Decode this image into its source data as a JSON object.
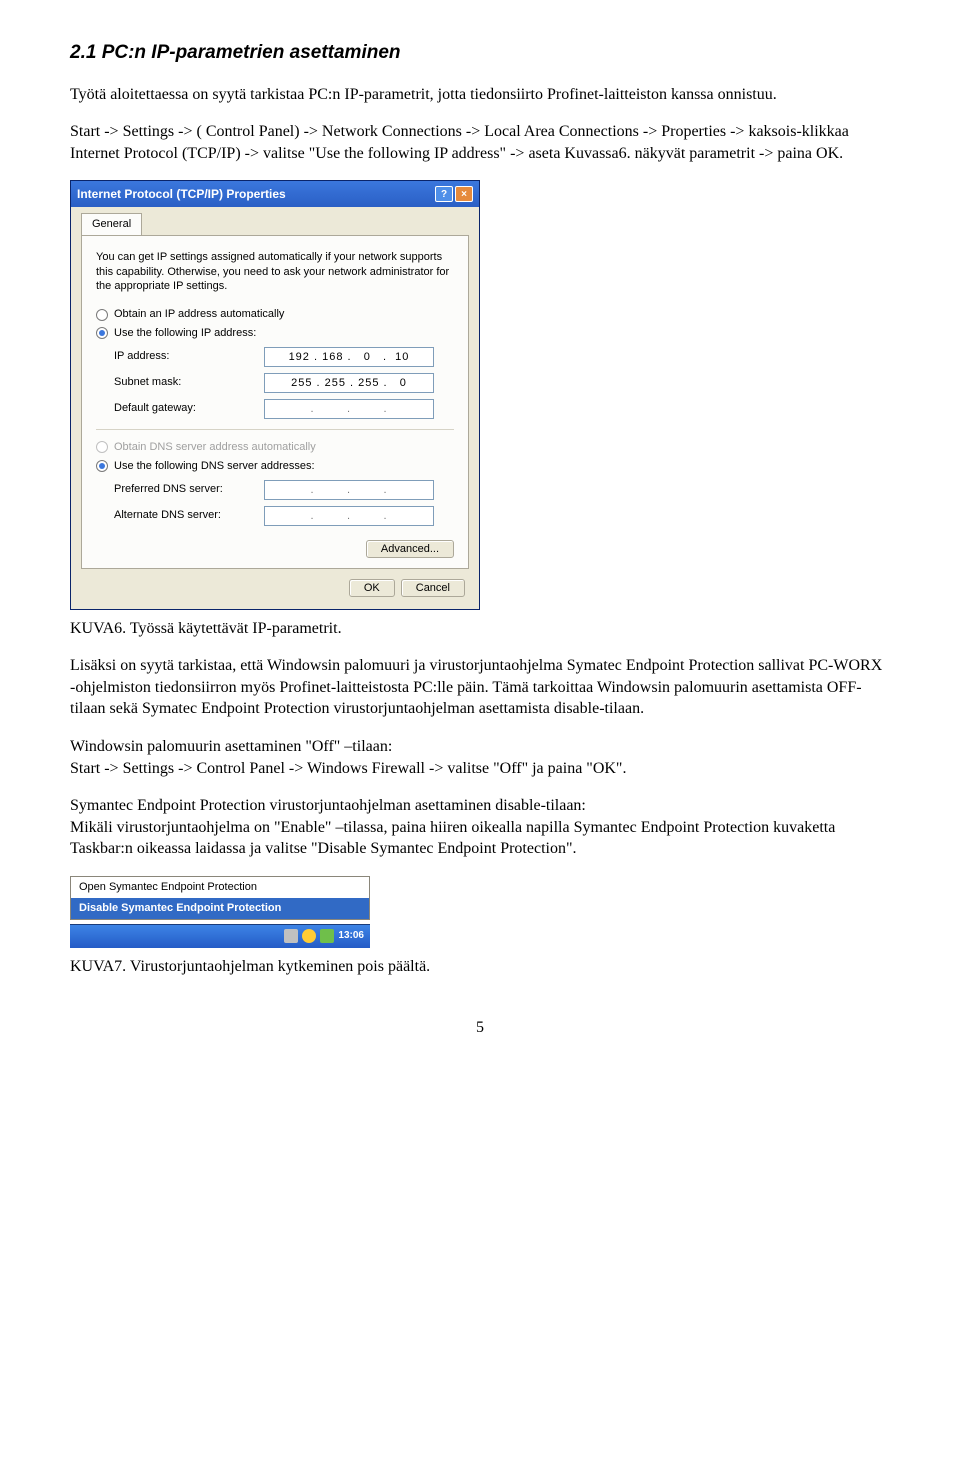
{
  "heading": "2.1  PC:n IP-parametrien asettaminen",
  "para1": "Työtä aloitettaessa on syytä tarkistaa PC:n IP-parametrit, jotta tiedonsiirto Profinet-laitteiston kanssa onnistuu.",
  "para2": "Start -> Settings -> ( Control Panel) -> Network Connections -> Local Area Connections -> Properties -> kaksois-klikkaa Internet Protocol (TCP/IP) -> valitse \"Use the following IP address\" -> aseta Kuvassa6. näkyvät parametrit -> paina OK.",
  "dialog": {
    "title": "Internet Protocol (TCP/IP) Properties",
    "tab": "General",
    "info": "You can get IP settings assigned automatically if your network supports this capability. Otherwise, you need to ask your network administrator for the appropriate IP settings.",
    "radio_auto_ip": "Obtain an IP address automatically",
    "radio_use_ip": "Use the following IP address:",
    "label_ip": "IP address:",
    "val_ip": "192 . 168 .   0   .  10",
    "label_subnet": "Subnet mask:",
    "val_subnet": "255 . 255 . 255 .   0",
    "label_gateway": "Default gateway:",
    "val_gateway": ".        .        .",
    "radio_auto_dns": "Obtain DNS server address automatically",
    "radio_use_dns": "Use the following DNS server addresses:",
    "label_pref_dns": "Preferred DNS server:",
    "val_pref_dns": ".        .        .",
    "label_alt_dns": "Alternate DNS server:",
    "val_alt_dns": ".        .        .",
    "btn_advanced": "Advanced...",
    "btn_ok": "OK",
    "btn_cancel": "Cancel"
  },
  "caption1": "KUVA6. Työssä käytettävät IP-parametrit.",
  "para3": "Lisäksi on syytä tarkistaa, että Windowsin palomuuri ja virustorjuntaohjelma Symatec Endpoint Protection sallivat PC-WORX -ohjelmiston tiedonsiirron myös Profinet-laitteistosta PC:lle päin. Tämä tarkoittaa Windowsin palomuurin asettamista OFF-tilaan sekä Symatec Endpoint Protection virustorjuntaohjelman asettamista disable-tilaan.",
  "para4_l1": "Windowsin palomuurin asettaminen \"Off\" –tilaan:",
  "para4_l2": "Start -> Settings -> Control Panel -> Windows Firewall -> valitse \"Off\" ja paina \"OK\".",
  "para5_l1": "Symantec Endpoint Protection virustorjuntaohjelman asettaminen disable-tilaan:",
  "para5_l2": "Mikäli virustorjuntaohjelma on \"Enable\" –tilassa, paina hiiren oikealla napilla Symantec Endpoint Protection kuvaketta Taskbar:n oikeassa laidassa ja valitse \"Disable Symantec Endpoint Protection\".",
  "sepmenu": {
    "open": "Open Symantec Endpoint Protection",
    "disable": "Disable Symantec Endpoint Protection",
    "time": "13:06"
  },
  "caption2": "KUVA7. Virustorjuntaohjelman kytkeminen pois päältä.",
  "page_num": "5"
}
